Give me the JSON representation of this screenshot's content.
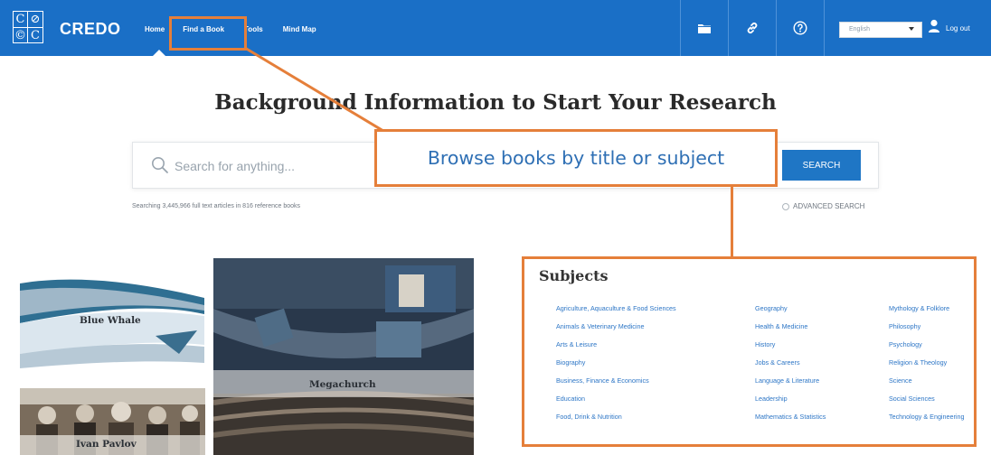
{
  "app": {
    "logo_text": "CREDO",
    "logo_glyphs": [
      "C",
      "⊘",
      "©",
      "C"
    ]
  },
  "nav": {
    "home": "Home",
    "find_book": "Find a Book",
    "tools": "Tools",
    "mind_map": "Mind Map"
  },
  "toolbar_icons": [
    "folder-icon",
    "link-icon",
    "help-icon"
  ],
  "language": {
    "selected": "English"
  },
  "logout_label": "Log out",
  "page": {
    "heading": "Background Information to Start Your Research"
  },
  "search": {
    "placeholder": "Search for anything...",
    "button": "SEARCH",
    "note": "Searching 3,445,966 full text articles in 816 reference books",
    "advanced": "ADVANCED SEARCH"
  },
  "images": {
    "whale": "Blue Whale",
    "megachurch": "Megachurch",
    "pavlov": "Ivan Pavlov"
  },
  "subjects": {
    "title": "Subjects",
    "col1": [
      "Agriculture, Aquaculture & Food Sciences",
      "Animals & Veterinary Medicine",
      "Arts & Leisure",
      "Biography",
      "Business, Finance & Economics",
      "Education",
      "Food, Drink & Nutrition"
    ],
    "col2": [
      "Geography",
      "Health & Medicine",
      "History",
      "Jobs & Careers",
      "Language & Literature",
      "Leadership",
      "Mathematics & Statistics"
    ],
    "col3": [
      "Mythology & Folklore",
      "Philosophy",
      "Psychology",
      "Religion & Theology",
      "Science",
      "Social Sciences",
      "Technology & Engineering"
    ]
  },
  "annotation": {
    "callout": "Browse books by title or subject"
  },
  "colors": {
    "brand_blue": "#1a6fc6",
    "link_blue": "#2d76c6",
    "annotation_orange": "#e57f3a"
  }
}
